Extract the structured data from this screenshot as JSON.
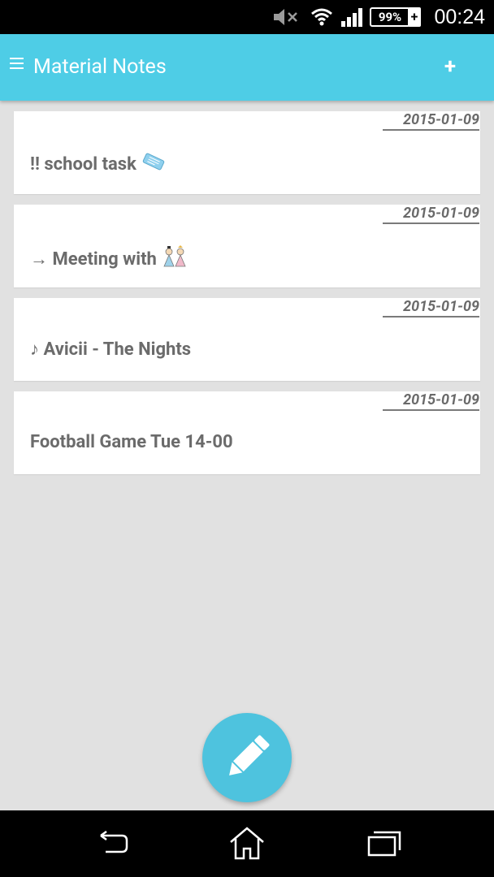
{
  "status_bar": {
    "icons": [
      "mute-icon",
      "wifi-icon",
      "signal-icon"
    ],
    "battery": "99%",
    "time": "00:24"
  },
  "app_bar": {
    "title": "Material Notes",
    "add_label": "+"
  },
  "notes": [
    {
      "date": "2015-01-09",
      "title": "!! school task",
      "emoji": "ticket-emoji-icon"
    },
    {
      "date": "2015-01-09",
      "title": "→ Meeting with",
      "emoji": "dolls-emoji-icon"
    },
    {
      "date": "2015-01-09",
      "title": "♪ Avicii - The Nights",
      "emoji": ""
    },
    {
      "date": "2015-01-09",
      "title": "Football Game Tue 14-00",
      "emoji": ""
    }
  ],
  "fab": {
    "icon": "pencil-icon"
  },
  "nav_bar": {
    "icons": [
      "back-icon",
      "home-icon",
      "recent-apps-icon"
    ]
  },
  "colors": {
    "accent": "#4ecde6",
    "fab": "#4ec3de",
    "background": "#e1e1e1",
    "text": "#6b6b6b"
  }
}
